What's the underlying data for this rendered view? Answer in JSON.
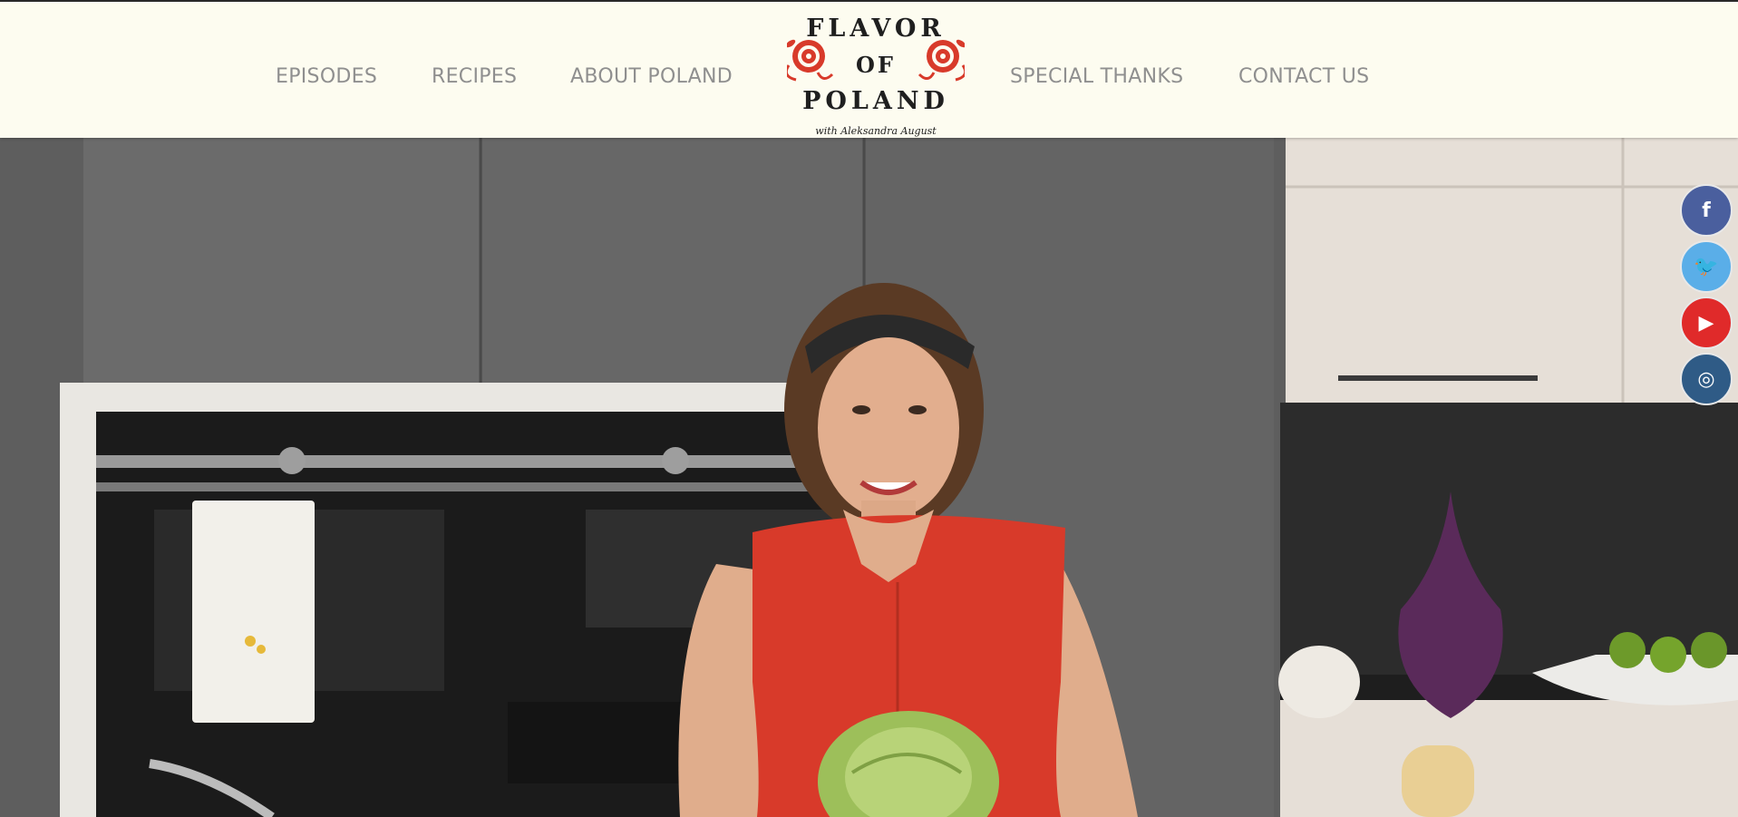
{
  "nav": {
    "left": [
      {
        "label": "EPISODES"
      },
      {
        "label": "RECIPES"
      },
      {
        "label": "ABOUT POLAND"
      }
    ],
    "right": [
      {
        "label": "SPECIAL THANKS"
      },
      {
        "label": "CONTACT US"
      }
    ]
  },
  "logo": {
    "line1": "FLAVOR",
    "line2": "OF",
    "line3": "POLAND",
    "tagline": "with Aleksandra August"
  },
  "social": [
    {
      "name": "facebook",
      "glyph": "f",
      "color": "#4a5f9e"
    },
    {
      "name": "twitter",
      "glyph": "🐦",
      "color": "#5aaee8"
    },
    {
      "name": "youtube",
      "glyph": "▶",
      "color": "#e02a2a"
    },
    {
      "name": "instagram",
      "glyph": "◎",
      "color": "#2f5b86"
    }
  ],
  "colors": {
    "header_bg": "#fdfcf0",
    "nav_text": "#8f8f8f",
    "accent_red": "#d83a2a"
  }
}
